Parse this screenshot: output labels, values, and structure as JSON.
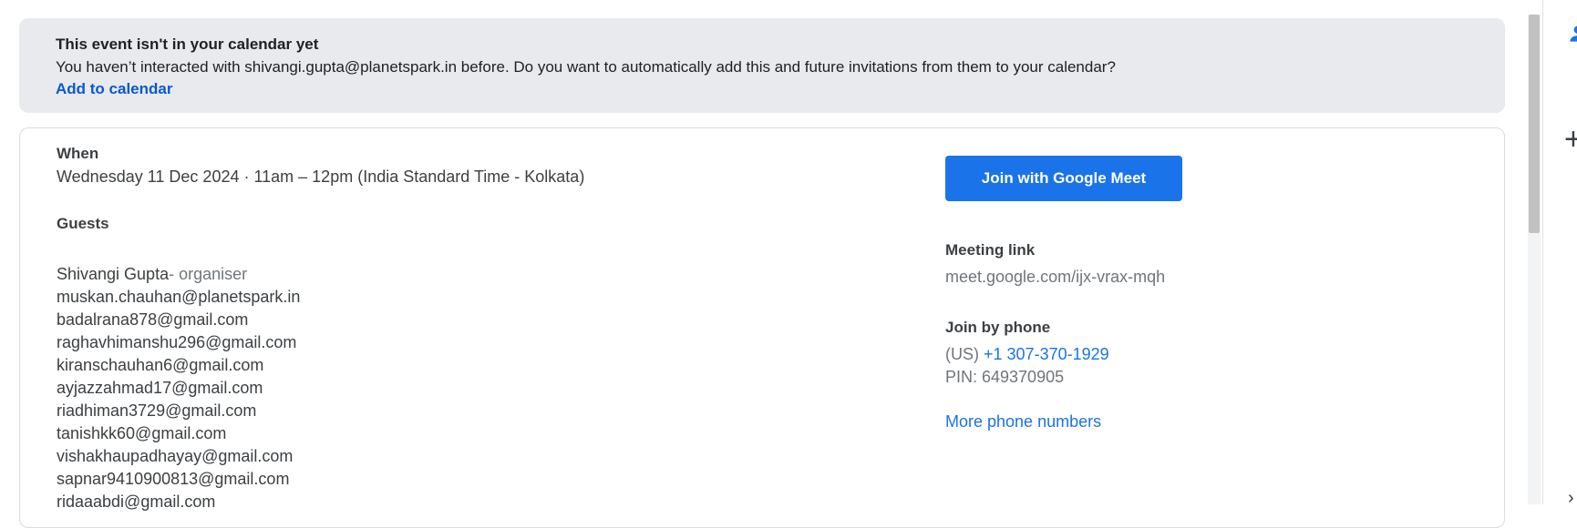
{
  "banner": {
    "title": "This event isn't in your calendar yet",
    "description": "You haven’t interacted with shivangi.gupta@planetspark.in before. Do you want to automatically add this and future invitations from them to your calendar?",
    "add_link": "Add to calendar"
  },
  "event": {
    "when_label": "When",
    "when_value": "Wednesday 11 Dec 2024 · 11am – 12pm (India Standard Time - Kolkata)",
    "guests_label": "Guests",
    "organiser_name": "Shivangi Gupta",
    "organiser_suffix": "- organiser",
    "guests": [
      "muskan.chauhan@planetspark.in",
      "badalrana878@gmail.com",
      "raghavhimanshu296@gmail.com",
      "kiranschauhan6@gmail.com",
      "ayjazzahmad17@gmail.com",
      "riadhiman3729@gmail.com",
      "tanishkk60@gmail.com",
      "vishakhaupadhayay@gmail.com",
      "sapnar9410900813@gmail.com",
      "ridaaabdi@gmail.com"
    ]
  },
  "meet": {
    "join_button": "Join with Google Meet",
    "link_label": "Meeting link",
    "link_value": "meet.google.com/ijx-vrax-mqh",
    "phone_label": "Join by phone",
    "phone_country": "(US)",
    "phone_number": "+1 307-370-1929",
    "pin": "PIN: 649370905",
    "more_numbers": "More phone numbers"
  },
  "rail": {
    "icons": [
      "person-icon",
      "add-icon",
      "chevron-right-icon"
    ],
    "accent": "#1a73e8"
  },
  "colors": {
    "banner_bg": "#e8eaed",
    "link_blue": "#0b57d0",
    "button_blue": "#1a73e8"
  }
}
